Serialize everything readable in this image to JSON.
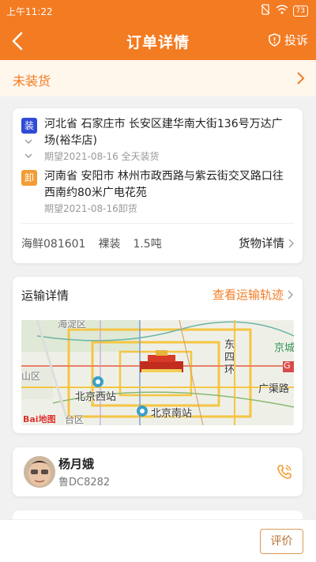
{
  "status_bar": {
    "time": "上午11:22",
    "battery": "73"
  },
  "nav": {
    "title": "订单详情",
    "complain_label": "投诉"
  },
  "order_status": {
    "label": "未装货"
  },
  "route": {
    "load": {
      "badge": "装",
      "address": "河北省 石家庄市 长安区建华南大街136号万达广场(裕华店)",
      "expect": "期望2021-08-16 全天装货"
    },
    "unload": {
      "badge": "卸",
      "address": "河南省 安阳市 林州市政西路与紫云街交叉路口往西南约80米广电花苑",
      "expect": "期望2021-08-16卸货"
    },
    "cargo": {
      "name": "海鲜081601",
      "packing": "裸装",
      "weight": "1.5吨",
      "detail_label": "货物详情"
    }
  },
  "transport": {
    "title": "运输详情",
    "track_label": "查看运输轨迹",
    "map": {
      "labels": {
        "haidian": "海淀区",
        "jingcheng": "京城",
        "dongsihuan": "东\n四\n环",
        "shanqu": "山区",
        "beijing_west": "北京西站",
        "guangqu": "广渠路",
        "beijing_south": "北京南站",
        "baidu": "Bai地图",
        "fengtai": "台区",
        "g": "G"
      }
    }
  },
  "driver": {
    "name": "杨月娥",
    "plate": "鲁DC8282"
  },
  "bottom": {
    "rate_label": "评价"
  }
}
